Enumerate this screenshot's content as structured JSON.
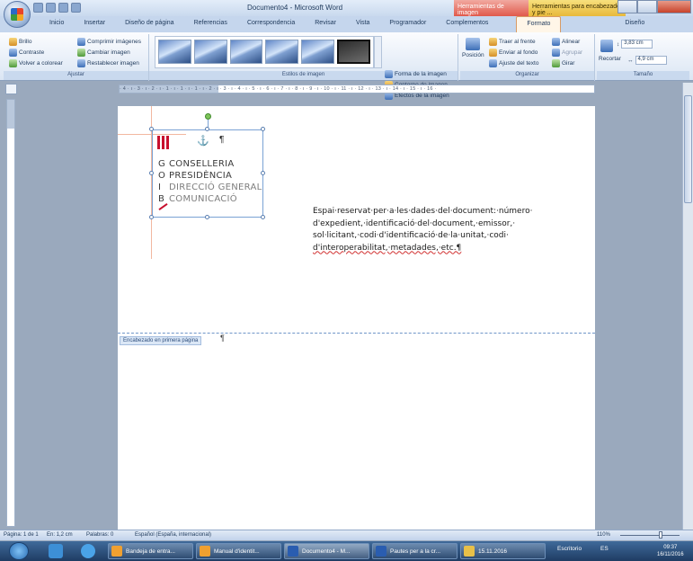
{
  "window": {
    "title": "Documento4 - Microsoft Word",
    "contextual_tabs": [
      "Herramientas de imagen",
      "Herramientas para encabezado y pie ..."
    ]
  },
  "ribbon": {
    "tabs": [
      "Inicio",
      "Insertar",
      "Diseño de página",
      "Referencias",
      "Correspondencia",
      "Revisar",
      "Vista",
      "Programador",
      "Complementos",
      "Formato",
      "Diseño"
    ],
    "active_tab": "Formato",
    "groups": {
      "ajustar": {
        "label": "Ajustar",
        "brillo": "Brillo",
        "contraste": "Contraste",
        "volver_colorear": "Volver a colorear",
        "comprimir": "Comprimir imágenes",
        "cambiar": "Cambiar imagen",
        "restablecer": "Restablecer imagen"
      },
      "estilos": {
        "label": "Estilos de imagen",
        "forma": "Forma de la imagen",
        "contorno": "Contorno de imagen",
        "efectos": "Efectos de la imagen"
      },
      "organizar": {
        "label": "Organizar",
        "posicion": "Posición",
        "traer": "Traer al frente",
        "enviar": "Enviar al fondo",
        "ajuste": "Ajuste del texto",
        "alinear": "Alinear",
        "agrupar": "Agrupar",
        "girar": "Girar"
      },
      "tamano": {
        "label": "Tamaño",
        "recortar": "Recortar",
        "height": "3,83 cm",
        "width": "4,9 cm"
      }
    }
  },
  "ruler": {
    "horizontal": "· 4 · ı · 3 · ı · 2 · ı · 1 · ı · 1 · ı · 1 · ı · 2 · ı · 3 · ı · 4 · ı · 5 · ı · 6 · ı · 7 · ı · 8 · ı · 9 · ı · 10 · ı · 11 · ı · 12 · ı · 13 · ı · 14 · ı · 15 · ı · 16 ·"
  },
  "document": {
    "logo_lines": [
      {
        "letter": "G",
        "text": "CONSELLERIA"
      },
      {
        "letter": "O",
        "text": "PRESIDÈNCIA"
      },
      {
        "letter": "I",
        "text": "DIRECCIÓ GENERAL"
      },
      {
        "letter": "B",
        "text": "COMUNICACIÓ"
      }
    ],
    "pilcrow": "¶",
    "anchor": "⚓",
    "body_line_1": "Espai·reservat·per·a·les·dades·del·document:·número·",
    "body_line_2": "d'expedient,·identificació·del·document,·emissor,·",
    "body_line_3": "sol·licitant,·codi·d'identificació·de·la·unitat,·codi·",
    "body_line_4": "d'interoperabilitat,·metadades,·etc.¶",
    "header_tag": "Encabezado en primera página"
  },
  "statusbar": {
    "page": "Página: 1 de 1",
    "position": "En: 1,2 cm",
    "words": "Palabras: 0",
    "language": "Español (España, internacional)",
    "zoom": "110%"
  },
  "taskbar": {
    "buttons": [
      "Bandeja de entra...",
      "Manual d'identit...",
      "Documento4 - M...",
      "Pautes per a la cr...",
      "15.11.2016"
    ],
    "desktop": "Escritorio",
    "lang": "ES",
    "time": "09:37",
    "date": "16/11/2016"
  },
  "colors": {
    "accent_red": "#c8102e",
    "ribbon_bg": "#dbe6f4",
    "workspace": "#9aa9bd"
  }
}
